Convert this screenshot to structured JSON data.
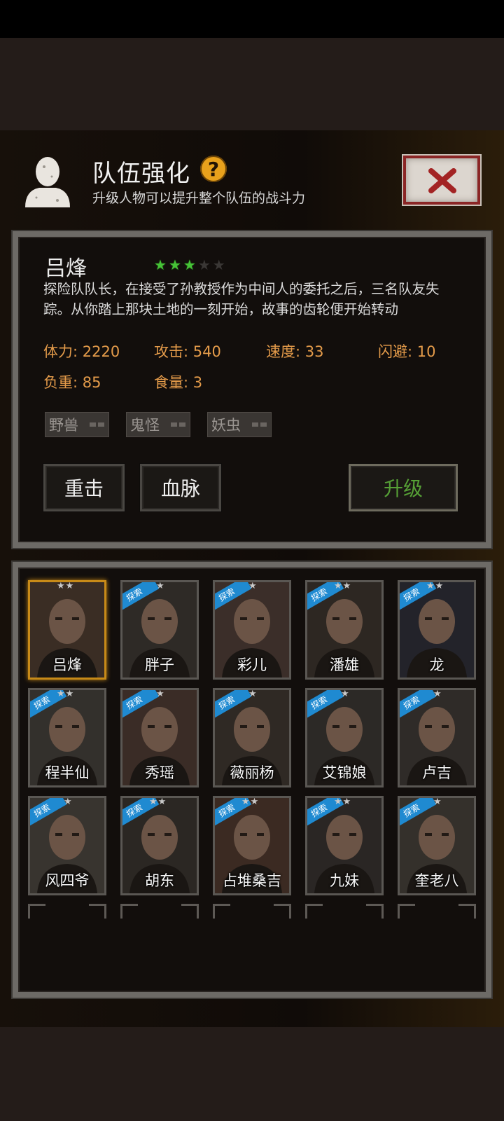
{
  "header": {
    "title": "队伍强化",
    "help_label": "?",
    "subtitle": "升级人物可以提升整个队伍的战斗力"
  },
  "character": {
    "name": "吕烽",
    "stars_filled": 3,
    "stars_total": 5,
    "description": "探险队队长，在接受了孙教授作为中间人的委托之后，三名队友失踪。从你踏上那块土地的一刻开始，故事的齿轮便开始转动",
    "stats": {
      "hp": "体力: 2220",
      "attack": "攻击: 540",
      "speed": "速度: 33",
      "dodge": "闪避: 10",
      "load": "负重: 85",
      "food": "食量: 3"
    },
    "tags": [
      "野兽",
      "鬼怪",
      "妖虫"
    ],
    "buttons": {
      "strike": "重击",
      "bloodline": "血脉",
      "upgrade": "升级"
    }
  },
  "roster": {
    "badge_label": "探索",
    "members": [
      {
        "name": "吕烽",
        "stars": "★★",
        "badge": false,
        "selected": true
      },
      {
        "name": "胖子",
        "stars": "★",
        "badge": true
      },
      {
        "name": "彩儿",
        "stars": "★",
        "badge": true
      },
      {
        "name": "潘雄",
        "stars": "★★",
        "badge": true
      },
      {
        "name": "龙",
        "stars": "★★",
        "badge": true
      },
      {
        "name": "程半仙",
        "stars": "★★",
        "badge": true
      },
      {
        "name": "秀瑶",
        "stars": "★",
        "badge": true
      },
      {
        "name": "薇丽杨",
        "stars": "★",
        "badge": true
      },
      {
        "name": "艾锦娘",
        "stars": "★",
        "badge": true
      },
      {
        "name": "卢吉",
        "stars": "★",
        "badge": true
      },
      {
        "name": "风四爷",
        "stars": "★",
        "badge": true
      },
      {
        "name": "胡东",
        "stars": "★★",
        "badge": true
      },
      {
        "name": "占堆桑吉",
        "stars": "★★",
        "badge": true
      },
      {
        "name": "九妹",
        "stars": "★★",
        "badge": true
      },
      {
        "name": "奎老八",
        "stars": "★",
        "badge": true
      }
    ]
  },
  "colors": {
    "accent_orange": "#e49b4a",
    "star_green": "#46c337",
    "upgrade_green": "#56a036",
    "badge_blue": "#1f8ad1",
    "selected_gold": "#c78a18"
  }
}
